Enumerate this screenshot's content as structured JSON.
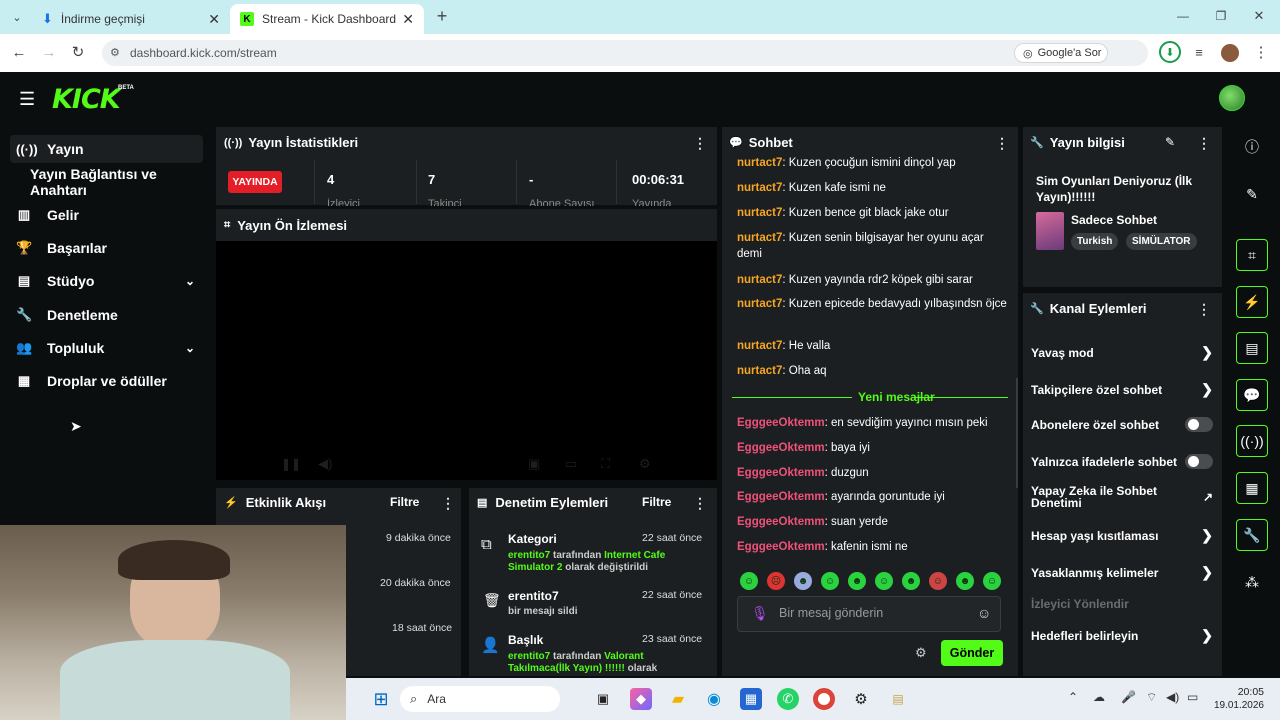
{
  "browser": {
    "tabs": [
      {
        "title": "İndirme geçmişi",
        "close": "✕"
      },
      {
        "title": "Stream - Kick Dashboard",
        "close": "✕"
      }
    ],
    "new_tab": "+",
    "url": "dashboard.kick.com/stream",
    "google_lens": "Google'a Sor",
    "window_controls": [
      "—",
      "❐",
      "✕"
    ]
  },
  "app": {
    "logo": "KICK",
    "logo_badge": "BETA"
  },
  "sidebar": {
    "items": [
      {
        "label": "Yayın",
        "icon": "broadcast-icon"
      },
      {
        "label": "Yayın Bağlantısı ve Anahtarı",
        "icon": ""
      },
      {
        "label": "Gelir",
        "icon": "chart-icon"
      },
      {
        "label": "Başarılar",
        "icon": "trophy-icon"
      },
      {
        "label": "Stüdyo",
        "icon": "studio-icon"
      },
      {
        "label": "Denetleme",
        "icon": "wrench-icon"
      },
      {
        "label": "Topluluk",
        "icon": "community-icon"
      },
      {
        "label": "Droplar ve ödüller",
        "icon": "gift-icon"
      }
    ]
  },
  "stats": {
    "title": "Yayın İstatistikleri",
    "live_badge": "YAYINDA",
    "items": [
      {
        "value": "4",
        "label": "İzleyici"
      },
      {
        "value": "7",
        "label": "Takipçi"
      },
      {
        "value": "-",
        "label": "Abone Sayısı"
      },
      {
        "value": "00:06:31",
        "label": "Yayında"
      }
    ]
  },
  "preview": {
    "title": "Yayın Ön İzlemesi"
  },
  "activity": {
    "title": "Etkinlik Akışı",
    "filter": "Filtre",
    "items": [
      {
        "time": "9 dakika önce"
      },
      {
        "time": "20 dakika önce"
      },
      {
        "time": "18 saat önce"
      }
    ]
  },
  "moderation": {
    "title": "Denetim Eylemleri",
    "filter": "Filtre",
    "items": [
      {
        "title": "Kategori",
        "time": "22 saat önce",
        "user": "erentito7",
        "mid": " tarafından ",
        "target": "Internet Cafe Simulator 2",
        "end": " olarak değiştirildi"
      },
      {
        "title": "erentito7",
        "time": "22 saat önce",
        "desc": "bir mesajı sildi"
      },
      {
        "title": "Başlık",
        "time": "23 saat önce",
        "user": "erentito7",
        "mid": " tarafından ",
        "target": "Valorant Takılmaca(İlk Yayın) !!!!!!",
        "end": " olarak"
      }
    ]
  },
  "chat": {
    "title": "Sohbet",
    "messages": [
      {
        "user": "nurtact7",
        "text": "Kuzen çocuğun ismini dinçol yap"
      },
      {
        "user": "nurtact7",
        "text": "Kuzen kafe ismi ne"
      },
      {
        "user": "nurtact7",
        "text": "Kuzen bence git black jake otur"
      },
      {
        "user": "nurtact7",
        "text": "Kuzen senin bilgisayar her oyunu açar demi"
      },
      {
        "user": "nurtact7",
        "text": "Kuzen yayında rdr2 köpek gibi sarar"
      },
      {
        "user": "nurtact7",
        "text": "Kuzen epicede bedavyadı yılbaşındsn öjce"
      },
      {
        "user": "nurtact7",
        "text": "He valla"
      },
      {
        "user": "nurtact7",
        "text": "Oha aq"
      }
    ],
    "new_divider": "Yeni mesajlar",
    "new_messages": [
      {
        "user": "EgggeeOktemm",
        "text": "en sevdiğim yayıncı mısın peki"
      },
      {
        "user": "EgggeeOktemm",
        "text": "baya iyi"
      },
      {
        "user": "EgggeeOktemm",
        "text": "duzgun"
      },
      {
        "user": "EgggeeOktemm",
        "text": "ayarında goruntude iyi"
      },
      {
        "user": "EgggeeOktemm",
        "text": "suan yerde"
      },
      {
        "user": "EgggeeOktemm",
        "text": "kafenin ismi ne"
      }
    ],
    "input_placeholder": "Bir mesaj gönderin",
    "send": "Gönder",
    "user_color_1": "#f5a623",
    "user_color_2": "#f0517a"
  },
  "stream_info": {
    "title": "Yayın bilgisi",
    "stream_title": "Sim Oyunları Deniyoruz (İlk Yayın)!!!!!!",
    "category": "Sadece Sohbet",
    "tags": [
      "Turkish",
      "SİMÜLATOR"
    ]
  },
  "channel_actions": {
    "title": "Kanal Eylemleri",
    "items": [
      {
        "label": "Yavaş mod",
        "kind": "arrow"
      },
      {
        "label": "Takipçilere özel sohbet",
        "kind": "arrow"
      },
      {
        "label": "Abonelere özel sohbet",
        "kind": "toggle"
      },
      {
        "label": "Yalnızca ifadelerle sohbet",
        "kind": "toggle"
      },
      {
        "label": "Yapay Zeka ile Sohbet Denetimi",
        "kind": "external"
      },
      {
        "label": "Hesap yaşı kısıtlaması",
        "kind": "arrow"
      },
      {
        "label": "Yasaklanmış kelimeler",
        "kind": "arrow"
      }
    ],
    "section": "İzleyici Yönlendir",
    "targets": "Hedefleri belirleyin"
  },
  "taskbar": {
    "search": "Ara",
    "time": "20:05",
    "date": "19.01.2026"
  },
  "colors": {
    "accent": "#53fc18",
    "live": "#e31e26"
  }
}
